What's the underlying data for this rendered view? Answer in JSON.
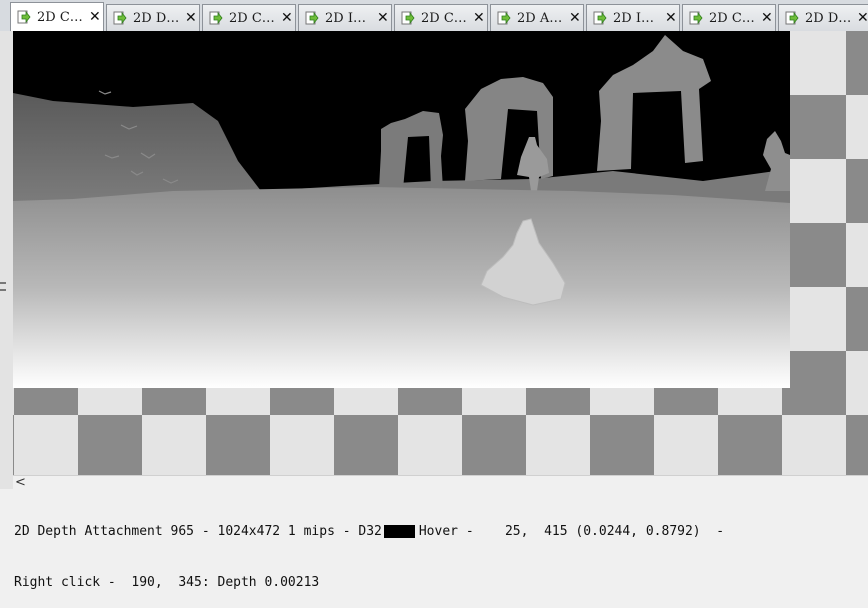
{
  "tabs": [
    {
      "label": "2D C…",
      "active": true
    },
    {
      "label": "2D D…",
      "active": false
    },
    {
      "label": "2D C…",
      "active": false
    },
    {
      "label": "2D I…",
      "active": false
    },
    {
      "label": "2D C…",
      "active": false
    },
    {
      "label": "2D A…",
      "active": false
    },
    {
      "label": "2D I…",
      "active": false
    },
    {
      "label": "2D C…",
      "active": false
    },
    {
      "label": "2D D…",
      "active": false
    }
  ],
  "tab_close_glyph": "✕",
  "tab_icon": "export-arrow-icon",
  "scroll_left_glyph": "<",
  "status": {
    "line1_info": "2D Depth Attachment 965 - 1024x472 1 mips - D32",
    "swatch_color": "#000000",
    "line1_hover": "Hover -    25,  415 (0.0244, 0.8792)  -",
    "line2": "Right click -  190,  345: Depth 0.00213"
  },
  "colors": {
    "tab_icon_fill": "#6fbe3a",
    "checker_dark": "#8a8a8a",
    "checker_light": "#e4e4e4"
  }
}
